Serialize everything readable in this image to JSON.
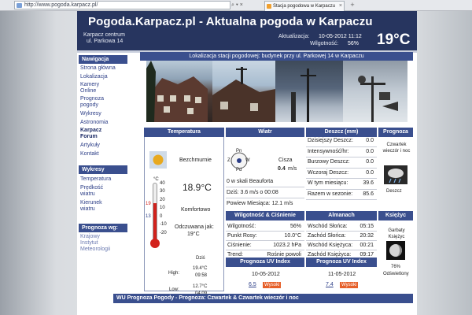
{
  "browser": {
    "url": "http://www.pogoda.karpacz.pl/",
    "address_controls": "⌕ ▾ ×",
    "tab_title": "Stacja pogodowa w Karpaczu",
    "tab_close": "×",
    "new_tab": "+"
  },
  "header": {
    "title": "Pogoda.Karpacz.pl - Aktualna pogoda w Karpaczu",
    "location_line1": "Karpacz centrum",
    "location_line2": "ul. Parkowa 14",
    "update_label": "Aktualizacja:",
    "update_value": "10-05-2012 11:12",
    "humidity_label": "Wilgotność:",
    "humidity_value": "56%",
    "temperature": "19°C"
  },
  "sidebar": {
    "nav_header": "Nawigacja",
    "nav_items": [
      "Strona główna",
      "Lokalizacja",
      "Kamery Online",
      "Prognoza pogody",
      "Wykresy",
      "Astronomia",
      "Karpacz Forum",
      "Artykuły",
      "Kontakt"
    ],
    "charts_header": "Wykresy",
    "chart_items": [
      "Temperatura",
      "Prędkość wiatru",
      "Kierunek wiatru"
    ],
    "forecast_header": "Prognoza wg:",
    "forecast_items": [
      "Krajowy Instytut Meteorologii"
    ]
  },
  "station_location": "Lokalizacja stacji pogodowej: budynek przy ul. Parkowej 14 w Karpaczu",
  "temperature_box": {
    "header": "Temperatura",
    "condition": "Bezchmurnie",
    "value": "18.9°C",
    "comfort": "Komfortowo",
    "feels_label": "Odczuwana jak:",
    "feels_value": "19°C",
    "day_label": "Dziś",
    "high_label": "High:",
    "high_value": "19.4°C",
    "high_time": "09:58",
    "low_label": "Low:",
    "low_value": "12.7°C",
    "low_time": "04:09",
    "thermo_top": "°C",
    "thermo_ticks": [
      "40",
      "30",
      "20",
      "10",
      "0",
      "-10",
      "-20"
    ],
    "thermo_markers": [
      "19",
      "13"
    ],
    "thermometer_level_c": 18.9
  },
  "wind_box": {
    "header": "Wiatr",
    "compass_labels": [
      "Pn",
      "Z",
      "W",
      "Pd"
    ],
    "calm_label": "Cisza",
    "speed": "0.4",
    "speed_unit": "m/s",
    "beaufort": "0 w skali Beauforta",
    "today": "Dziś: 3.6 m/s o 00:08",
    "monthly": "Powiew Miesiąca: 12.1 m/s"
  },
  "rain_box": {
    "header": "Deszcz (mm)",
    "rows": [
      {
        "label": "Dzisiejszy Deszcz:",
        "value": "0.0"
      },
      {
        "label": "Intensywność/hr:",
        "value": "0.0"
      },
      {
        "label": "Burzowy Deszcz:",
        "value": "0.0"
      },
      {
        "label": "Wczoraj Deszcz:",
        "value": "0.0"
      },
      {
        "label": "W tym miesiącu:",
        "value": "39.6"
      },
      {
        "label": "Razem w sezonie:",
        "value": "85.6"
      }
    ]
  },
  "forecast_box": {
    "header": "Prognoza",
    "label": "Czwartek wieczór i noc",
    "condition": "Deszcz"
  },
  "humidity_box": {
    "header": "Wilgotność & Ciśnienie",
    "rows": [
      {
        "label": "Wilgotność:",
        "value": "56%"
      },
      {
        "label": "Punkt Rosy:",
        "value": "10.0°C"
      },
      {
        "label": "Ciśnienie:",
        "value": "1023.2 hPa"
      },
      {
        "label": "Trend:",
        "value": "Rośnie powoli"
      }
    ]
  },
  "almanac_box": {
    "header": "Almanach",
    "rows": [
      {
        "label": "Wschód Słońca:",
        "value": "05:15"
      },
      {
        "label": "Zachód Słońca:",
        "value": "20:32"
      },
      {
        "label": "Wschód Księżyca:",
        "value": "00:21"
      },
      {
        "label": "Zachód Księżyca:",
        "value": "09:17"
      }
    ]
  },
  "moon_box": {
    "header": "Księżyc",
    "phase": "Garbaty Księżyc",
    "percent": "76%",
    "percent_label": "Odświetlony"
  },
  "uv": [
    {
      "header": "Prognoza UV Index",
      "date": "10-05-2012",
      "value": "6.5",
      "level": "Wysoki"
    },
    {
      "header": "Prognoza UV Index",
      "date": "11-05-2012",
      "value": "7.4",
      "level": "Wysoki"
    }
  ],
  "footer_bar": "WU Prognoza Pogody  -  Prognoza: Czwartek & Czwartek wieczór i noc",
  "colors": {
    "header_bg": "#27355f",
    "section_header_bg": "#3a4f8e",
    "link": "#2b3d86",
    "badge": "#e6602a",
    "thermo_red": "#d2221c"
  }
}
